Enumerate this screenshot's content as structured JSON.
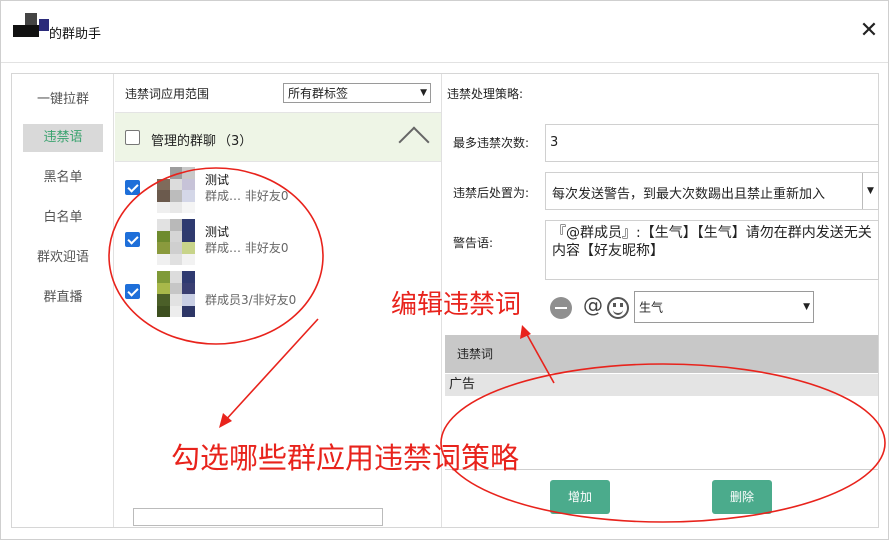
{
  "window": {
    "title": "的群助手",
    "close_glyph": "✕"
  },
  "nav": {
    "items": [
      {
        "label": "一键拉群"
      },
      {
        "label": "违禁语"
      },
      {
        "label": "黑名单"
      },
      {
        "label": "白名单"
      },
      {
        "label": "群欢迎语"
      },
      {
        "label": "群直播"
      }
    ],
    "active_index": 1
  },
  "scope": {
    "label": "违禁词应用范围",
    "tag_select": "所有群标签",
    "group_header": {
      "label": "管理的群聊",
      "count": "（3）"
    },
    "groups": [
      {
        "name": "测试",
        "sub": "群成… 非好友0",
        "checked": true
      },
      {
        "name": "测试",
        "sub": "群成… 非好友0",
        "checked": true
      },
      {
        "name": "",
        "sub": "群成员3/非好友0",
        "checked": true
      }
    ]
  },
  "strategy": {
    "title": "违禁处理策略:",
    "max_label": "最多违禁次数:",
    "max_value": "3",
    "action_label": "违禁后处置为:",
    "action_value": "每次发送警告，到最大次数踢出且禁止重新加入",
    "warning_label": "警告语:",
    "warning_text": "『@群成员』:【生气】【生气】请勿在群内发送无关内容【好友昵称】",
    "emoji_select": "生气",
    "table_header": "违禁词",
    "words": [
      "广告"
    ],
    "add_label": "增加",
    "delete_label": "删除"
  },
  "annotations": {
    "edit_words": "编辑违禁词",
    "select_groups": "勾选哪些群应用违禁词策略"
  },
  "colors": {
    "accent_green": "#4bab8c",
    "active_text": "#3aa36f",
    "annotation_red": "#e8231c",
    "checkbox_blue": "#1e6fd9"
  }
}
